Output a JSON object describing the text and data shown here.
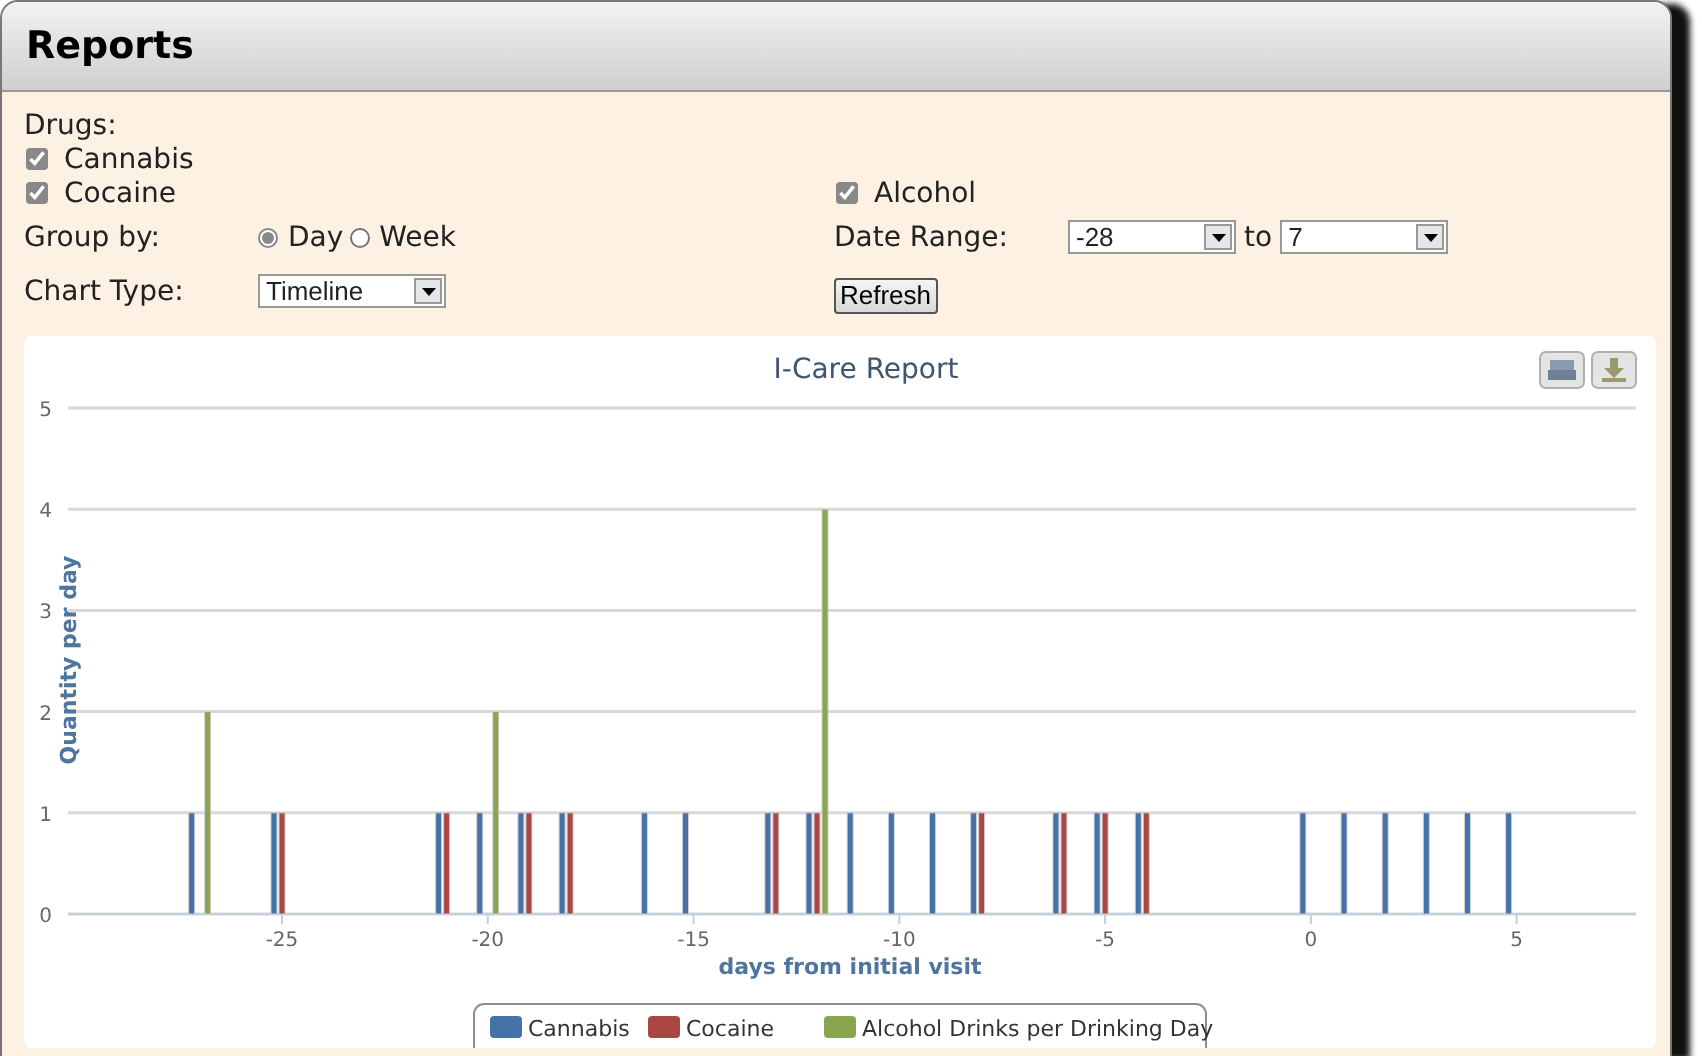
{
  "window": {
    "title": "Reports"
  },
  "filters": {
    "drugs_label": "Drugs:",
    "drugs": [
      {
        "label": "Cannabis",
        "checked": true
      },
      {
        "label": "Cocaine",
        "checked": true
      },
      {
        "label": "Alcohol",
        "checked": true
      }
    ],
    "group_by": {
      "label": "Group by:",
      "options": [
        {
          "label": "Day",
          "selected": true
        },
        {
          "label": "Week",
          "selected": false
        }
      ]
    },
    "date_range": {
      "label": "Date Range:",
      "from": "-28",
      "separator": "to",
      "to": "7"
    },
    "chart_type": {
      "label": "Chart Type:",
      "value": "Timeline"
    },
    "refresh_button": "Refresh"
  },
  "chart": {
    "chart_data": {
      "type": "bar",
      "title": "I-Care Report",
      "xlabel": "days from initial visit",
      "ylabel": "Quantity per day",
      "x": [
        -27,
        -25,
        -21,
        -20,
        -19,
        -18,
        -16,
        -15,
        -13,
        -12,
        -11,
        -10,
        -9,
        -8,
        -6,
        -5,
        -4,
        0,
        1,
        2,
        3,
        4,
        5
      ],
      "series": [
        {
          "name": "Cannabis",
          "color": "#4572a7",
          "values": [
            1,
            1,
            1,
            1,
            1,
            1,
            1,
            1,
            1,
            1,
            1,
            1,
            1,
            1,
            1,
            1,
            1,
            1,
            1,
            1,
            1,
            1,
            1
          ]
        },
        {
          "name": "Cocaine",
          "color": "#aa4643",
          "values": [
            null,
            1,
            1,
            null,
            1,
            1,
            null,
            null,
            1,
            1,
            null,
            null,
            null,
            1,
            1,
            1,
            1,
            null,
            null,
            null,
            null,
            null,
            null
          ]
        },
        {
          "name": "Alcohol Drinks per Drinking Day",
          "color": "#89a54e",
          "values": [
            2,
            null,
            null,
            2,
            null,
            null,
            null,
            null,
            null,
            4,
            null,
            null,
            null,
            null,
            null,
            null,
            null,
            null,
            null,
            null,
            null,
            null,
            null
          ]
        }
      ],
      "grid": true,
      "legend": "bottom",
      "xlim": [
        -30.2,
        7.9
      ],
      "ylim": [
        0,
        5
      ],
      "xticks": [
        -25,
        -20,
        -15,
        -10,
        -5,
        0,
        5
      ],
      "yticks": [
        0,
        1,
        2,
        3,
        4,
        5
      ]
    }
  }
}
